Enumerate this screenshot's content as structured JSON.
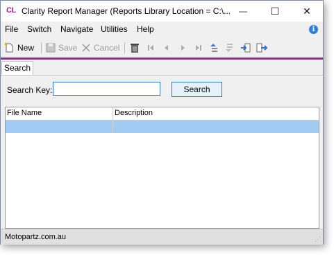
{
  "window": {
    "app_icon_text": "CL",
    "title": "Clarity Report Manager (Reports Library Location = C:\\...",
    "minimize_glyph": "—",
    "maximize_glyph": "☐",
    "close_glyph": "✕"
  },
  "menu": {
    "items": [
      {
        "label": "File"
      },
      {
        "label": "Switch"
      },
      {
        "label": "Navigate"
      },
      {
        "label": "Utilities"
      },
      {
        "label": "Help"
      }
    ],
    "help_icon_glyph": "i"
  },
  "toolbar": {
    "new_label": "New",
    "save_label": "Save",
    "cancel_label": "Cancel",
    "icons": {
      "new": "new-document-icon",
      "save": "save-icon",
      "cancel": "cancel-icon",
      "delete": "trash-icon",
      "first": "first-record-icon",
      "prev": "previous-record-icon",
      "next": "next-record-icon",
      "last": "last-record-icon",
      "sort_asc": "sort-ascending-icon",
      "sort_desc": "sort-descending-icon",
      "import": "import-icon",
      "export": "export-icon"
    }
  },
  "tabs": [
    {
      "label": "Search",
      "active": true
    }
  ],
  "search": {
    "label": "Search Key:",
    "value": "",
    "button_label": "Search"
  },
  "grid": {
    "columns": [
      "File Name",
      "Description"
    ],
    "rows": [
      {
        "file_name": "",
        "description": "",
        "selected": true
      }
    ]
  },
  "status": {
    "text": "Motopartz.com.au"
  },
  "colors": {
    "accent_line": "#a0209a",
    "app_icon": "#c0148c",
    "selected_row": "#9fcbf4",
    "button_border": "#2a6fc8"
  }
}
